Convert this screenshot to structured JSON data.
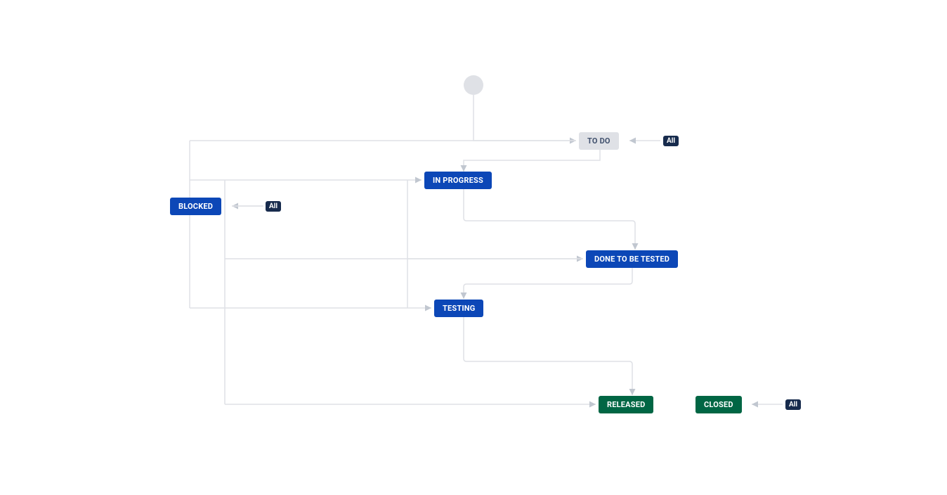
{
  "workflow": {
    "nodes": {
      "todo": {
        "label": "TO DO",
        "category": "todo"
      },
      "inprogress": {
        "label": "IN PROGRESS",
        "category": "inprogress"
      },
      "blocked": {
        "label": "BLOCKED",
        "category": "inprogress"
      },
      "donetbt": {
        "label": "DONE TO BE TESTED",
        "category": "inprogress"
      },
      "testing": {
        "label": "TESTING",
        "category": "inprogress"
      },
      "released": {
        "label": "RELEASED",
        "category": "done"
      },
      "closed": {
        "label": "CLOSED",
        "category": "done"
      }
    },
    "global_transition_label": "All",
    "colors": {
      "todo_bg": "#DFE1E6",
      "todo_fg": "#42526E",
      "inprogress_bg": "#0C47B7",
      "inprogress_fg": "#FFFFFF",
      "done_bg": "#006644",
      "done_fg": "#FFFFFF",
      "all_bg": "#172B4D",
      "all_fg": "#FFFFFF",
      "edge": "#DFE1E6"
    }
  }
}
